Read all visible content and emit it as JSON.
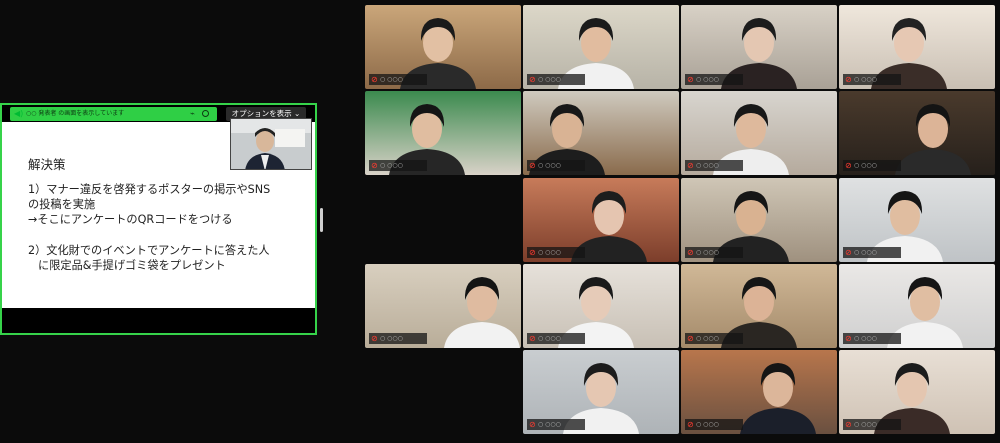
{
  "share": {
    "bar_text": "○○ 発表者 の画面を表示しています",
    "options_label": "オプションを表示",
    "options_chevron": "chevron-down-icon",
    "border_color": "#36d34a"
  },
  "slide": {
    "title": "解決策",
    "lines": [
      "1）マナー違反を啓発するポスターの掲示やSNS",
      "の投稿を実施",
      "→そこにアンケートのQRコードをつける",
      "2）文化財でのイベントでアンケートに答えた人",
      "に限定品&手提げゴミ袋をプレゼント"
    ]
  },
  "gallery": {
    "tiles": [
      {
        "label": "○ ○○○",
        "muted": true
      },
      {
        "label": "○ ○○○",
        "muted": true
      },
      {
        "label": "○ ○○○",
        "muted": true
      },
      {
        "label": "○ ○○○",
        "muted": true
      },
      {
        "label": "○ ○○○",
        "muted": true
      },
      {
        "label": "○ ○○○",
        "muted": true
      },
      {
        "label": "○ ○○○",
        "muted": true
      },
      {
        "label": "○ ○○○",
        "muted": true
      },
      {
        "label": "○ ○○○",
        "muted": true
      },
      {
        "label": "○ ○○○",
        "muted": true
      },
      {
        "label": "○ ○○○",
        "muted": true
      },
      {
        "label": "○ ○○○",
        "muted": true
      },
      {
        "label": "○ ○○○",
        "muted": true
      },
      {
        "label": "○ ○○○",
        "muted": true
      },
      {
        "label": "○ ○○○",
        "muted": true
      },
      {
        "label": "○ ○○○",
        "muted": true
      },
      {
        "label": "○ ○○○",
        "muted": true
      },
      {
        "label": "○ ○○○",
        "muted": true
      },
      {
        "label": "○ ○○○",
        "muted": true
      },
      {
        "label": "○ ○○○",
        "muted": true
      },
      {
        "label": "○ ○○○",
        "muted": true
      },
      {
        "label": "○ ○○○",
        "muted": true
      },
      {
        "label": "○ ○○○",
        "muted": true
      },
      {
        "label": "○ ○○○",
        "muted": true
      }
    ]
  },
  "colors": {
    "speaking_outline": "#c9d94a",
    "muted_icon": "#ff3b30"
  }
}
